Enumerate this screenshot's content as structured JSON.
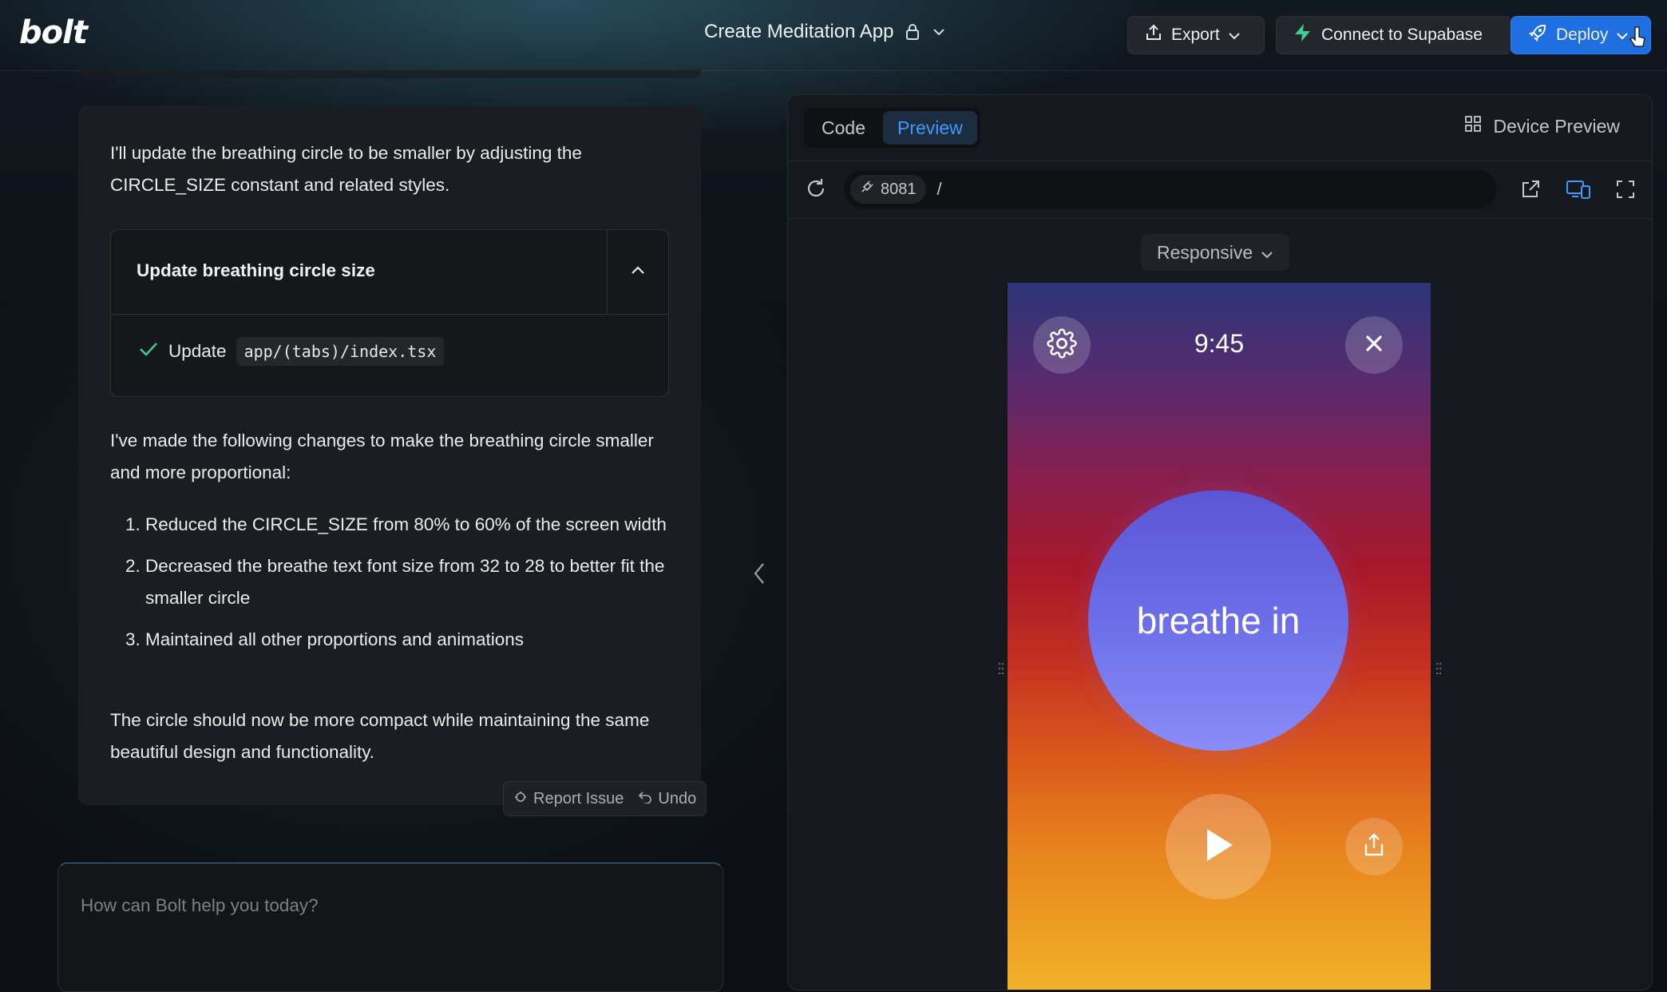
{
  "app": {
    "logo": "bolt",
    "project_title": "Create Meditation App"
  },
  "header": {
    "export_label": "Export",
    "supabase_label": "Connect to Supabase",
    "deploy_label": "Deploy"
  },
  "chat": {
    "intro": "I'll update the breathing circle to be smaller by adjusting the CIRCLE_SIZE constant and related styles.",
    "action": {
      "title": "Update breathing circle size",
      "step_verb": "Update",
      "step_file": "app/(tabs)/index.tsx"
    },
    "changes_intro": "I've made the following changes to make the breathing circle smaller and more proportional:",
    "changes": [
      "Reduced the CIRCLE_SIZE from 80% to 60% of the screen width",
      "Decreased the breathe text font size from 32 to 28 to better fit the smaller circle",
      "Maintained all other proportions and animations"
    ],
    "outro": "The circle should now be more compact while maintaining the same beautiful design and functionality.",
    "report_issue": "Report Issue",
    "undo": "Undo",
    "input_placeholder": "How can Bolt help you today?"
  },
  "workbench": {
    "tabs": [
      {
        "label": "Code",
        "active": false
      },
      {
        "label": "Preview",
        "active": true
      }
    ],
    "device_preview": "Device Preview",
    "port": "8081",
    "path": "/",
    "responsive": "Responsive"
  },
  "preview": {
    "time": "9:45",
    "breath_text": "breathe in"
  },
  "colors": {
    "accent": "#3d9bff",
    "deploy": "#1f6fe0",
    "supabase": "#3ecf8e",
    "circle": "#6c6ee8"
  }
}
